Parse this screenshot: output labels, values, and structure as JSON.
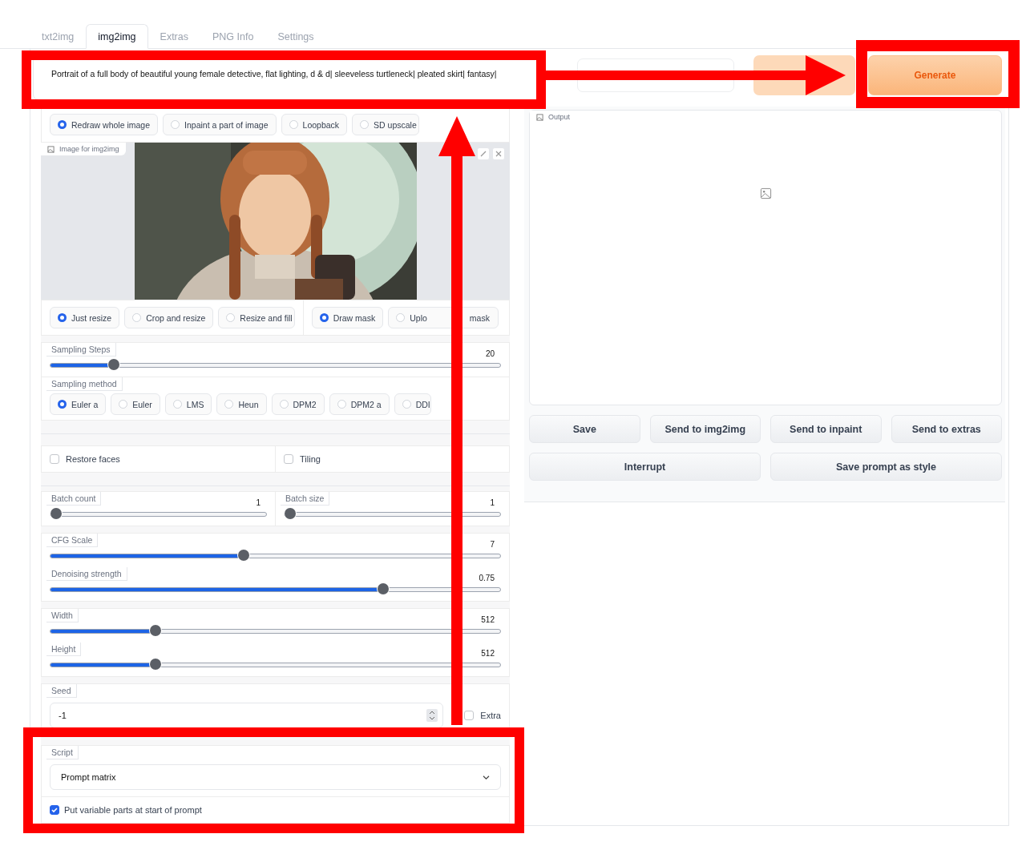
{
  "tabs": [
    {
      "label": "txt2img",
      "selected": false
    },
    {
      "label": "img2img",
      "selected": true
    },
    {
      "label": "Extras",
      "selected": false
    },
    {
      "label": "PNG Info",
      "selected": false
    },
    {
      "label": "Settings",
      "selected": false
    }
  ],
  "prompt": {
    "value": "Portrait of a full body of beautiful young female detective, flat lighting, d & d| sleeveless turtleneck| pleated skirt| fantasy|"
  },
  "generate_button": "Generate",
  "mode_options": [
    {
      "label": "Redraw whole image",
      "selected": true
    },
    {
      "label": "Inpaint a part of image",
      "selected": false
    },
    {
      "label": "Loopback",
      "selected": false
    },
    {
      "label": "SD upscale",
      "selected": false
    }
  ],
  "image_input": {
    "label": "Image for img2img",
    "kind": "picture"
  },
  "resize_options": [
    {
      "label": "Just resize",
      "selected": true
    },
    {
      "label": "Crop and resize",
      "selected": false
    },
    {
      "label": "Resize and fill",
      "selected": false
    }
  ],
  "mask_options": [
    {
      "label": "Draw mask",
      "selected": true
    },
    {
      "label": "Uplo",
      "label_tail": "mask",
      "selected": false
    }
  ],
  "sampling_steps": {
    "label": "Sampling Steps",
    "reading": "20",
    "level": 0.14
  },
  "sampling_method": {
    "label": "Sampling method",
    "options": [
      {
        "label": "Euler a",
        "selected": true
      },
      {
        "label": "Euler",
        "selected": false
      },
      {
        "label": "LMS",
        "selected": false
      },
      {
        "label": "Heun",
        "selected": false
      },
      {
        "label": "DPM2",
        "selected": false
      },
      {
        "label": "DPM2 a",
        "selected": false
      },
      {
        "label": "DDI",
        "selected": false
      }
    ]
  },
  "checkboxes": [
    {
      "label": "Restore faces",
      "checked": false
    },
    {
      "label": "Tiling",
      "checked": false
    }
  ],
  "batch": [
    {
      "label": "Batch count",
      "reading": "1",
      "level": 0
    },
    {
      "label": "Batch size",
      "reading": "1",
      "level": 0
    }
  ],
  "guidance": [
    {
      "label": "CFG Scale",
      "reading": "7",
      "level": 0.43
    },
    {
      "label": "Denoising strength",
      "reading": "0.75",
      "level": 0.74
    }
  ],
  "size": [
    {
      "label": "Width",
      "reading": "512",
      "level": 0.234
    },
    {
      "label": "Height",
      "reading": "512",
      "level": 0.234
    }
  ],
  "seed": {
    "label": "Seed",
    "value": "-1",
    "extra": {
      "label": "Extra",
      "checked": false
    }
  },
  "script": {
    "label": "Script",
    "value": "Prompt matrix",
    "option": {
      "label": "Put variable parts at start of prompt",
      "checked": true
    }
  },
  "output": {
    "label": "Output"
  },
  "output_buttons": [
    [
      "Save",
      "Send to img2img",
      "Send to inpaint",
      "Send to extras"
    ],
    [
      "Interrupt",
      "Save prompt as style"
    ]
  ]
}
